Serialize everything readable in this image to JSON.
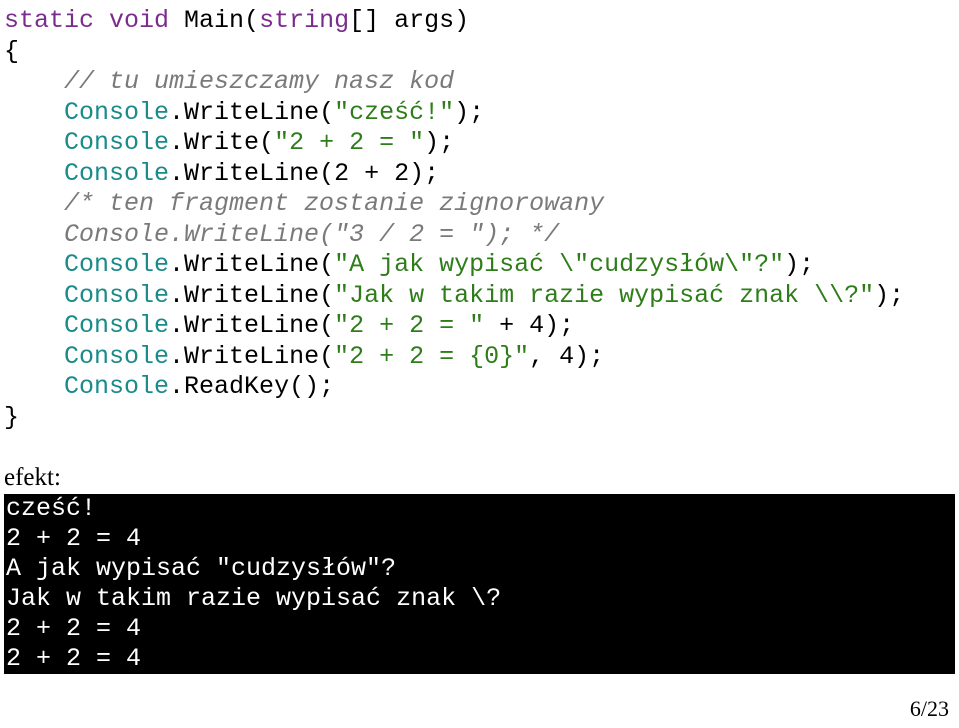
{
  "code": {
    "l1_kw1": "static",
    "l1_kw2": "void",
    "l1_name": " Main(",
    "l1_kw3": "string",
    "l1_rest": "[] args)",
    "l2": "{",
    "l3_indent": "    ",
    "l3_comment": "// tu umieszczamy nasz kod",
    "l4_indent": "    ",
    "l4_class": "Console",
    "l4_name": ".WriteLine(",
    "l4_str": "\"cześć!\"",
    "l4_end": ");",
    "l5_indent": "    ",
    "l5_class": "Console",
    "l5_name": ".Write(",
    "l5_str": "\"2 + 2 = \"",
    "l5_end": ");",
    "l6_indent": "    ",
    "l6_class": "Console",
    "l6_name": ".WriteLine(2 + 2);",
    "l7_indent": "    ",
    "l7_comment": "/* ten fragment zostanie zignorowany",
    "l8_indent": "    ",
    "l8_comment": "Console.WriteLine(\"3 / 2 = \"); */",
    "l9_indent": "    ",
    "l9_class": "Console",
    "l9_name": ".WriteLine(",
    "l9_str": "\"A jak wypisać \\\"cudzysłów\\\"?\"",
    "l9_end": ");",
    "l10_indent": "    ",
    "l10_class": "Console",
    "l10_name": ".WriteLine(",
    "l10_str": "\"Jak w takim razie wypisać znak \\\\?\"",
    "l10_end": ");",
    "l11_indent": "    ",
    "l11_class": "Console",
    "l11_name": ".WriteLine(",
    "l11_str": "\"2 + 2 = \"",
    "l11_end": " + 4);",
    "l12_indent": "    ",
    "l12_class": "Console",
    "l12_name": ".WriteLine(",
    "l12_str": "\"2 + 2 = {0}\"",
    "l12_end": ", 4);",
    "l13_indent": "    ",
    "l13_class": "Console",
    "l13_name": ".ReadKey();",
    "l14": "}"
  },
  "effect_label": "efekt:",
  "output": "cześć!\n2 + 2 = 4\nA jak wypisać \"cudzysłów\"?\nJak w takim razie wypisać znak \\?\n2 + 2 = 4\n2 + 2 = 4",
  "page_number": "6/23"
}
